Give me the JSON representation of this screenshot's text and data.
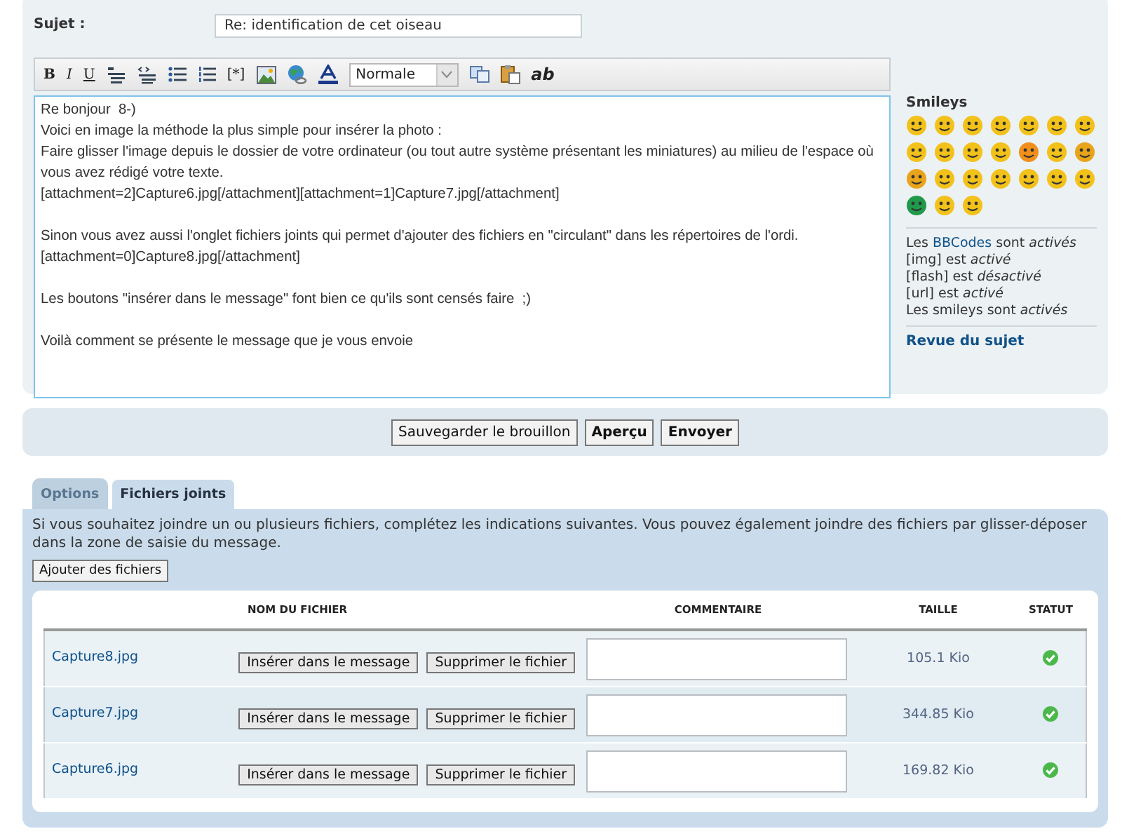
{
  "subject": {
    "label": "Sujet :",
    "value": "Re: identification de cet oiseau"
  },
  "toolbar": [
    {
      "kind": "bold",
      "label": "B"
    },
    {
      "kind": "italic",
      "label": "I"
    },
    {
      "kind": "underline",
      "label": "U"
    },
    {
      "kind": "quote"
    },
    {
      "kind": "code"
    },
    {
      "kind": "list"
    },
    {
      "kind": "list-numbered"
    },
    {
      "kind": "list-item",
      "label": "[*]"
    },
    {
      "kind": "image"
    },
    {
      "kind": "link"
    },
    {
      "kind": "color"
    },
    {
      "kind": "select",
      "value": "Normale"
    },
    {
      "kind": "copy"
    },
    {
      "kind": "paste"
    },
    {
      "kind": "spellcheck",
      "label": "ab"
    }
  ],
  "message": "Re bonjour  8-)\nVoici en image la méthode la plus simple pour insérer la photo :\nFaire glisser l'image depuis le dossier de votre ordinateur (ou tout autre système présentant les miniatures) au milieu de l'espace où vous avez rédigé votre texte.\n[attachment=2]Capture6.jpg[/attachment][attachment=1]Capture7.jpg[/attachment]\n\nSinon vous avez aussi l'onglet fichiers joints qui permet d'ajouter des fichiers en \"circulant\" dans les répertoires de l'ordi.\n[attachment=0]Capture8.jpg[/attachment]\n\nLes boutons \"insérer dans le message\" font bien ce qu'ils sont censés faire  ;)\n\nVoilà comment se présente le message que je vous envoie",
  "sidebar": {
    "smileys_title": "Smileys",
    "smileys": [
      {
        "color": "#f2c21b"
      },
      {
        "color": "#f2c21b"
      },
      {
        "color": "#f2c21b"
      },
      {
        "color": "#f2c21b"
      },
      {
        "color": "#f2c21b"
      },
      {
        "color": "#f2c21b"
      },
      {
        "color": "#f2c21b"
      },
      {
        "color": "#f2c21b"
      },
      {
        "color": "#f2c21b"
      },
      {
        "color": "#f2c21b"
      },
      {
        "color": "#f2c21b"
      },
      {
        "color": "#f0901a"
      },
      {
        "color": "#f2c21b"
      },
      {
        "color": "#e8a41a"
      },
      {
        "color": "#e8a41a"
      },
      {
        "color": "#f2c21b"
      },
      {
        "color": "#f2c21b"
      },
      {
        "color": "#f2c21b"
      },
      {
        "color": "#f2c21b"
      },
      {
        "color": "#f2c21b"
      },
      {
        "color": "#f2c21b"
      },
      {
        "color": "#1f9a4a"
      },
      {
        "color": "#f2c21b"
      },
      {
        "color": "#f2c21b"
      }
    ],
    "status_lines": [
      {
        "before": "Les ",
        "link": "BBCodes",
        "after": " sont *activés*"
      },
      {
        "before": "[img] est *activé*"
      },
      {
        "before": "[flash] est *désactivé*"
      },
      {
        "before": "[url] est *activé*"
      },
      {
        "before": "Les smileys sont *activés*"
      }
    ],
    "review_link": "Revue du sujet"
  },
  "actions": [
    {
      "label": "Sauvegarder le brouillon",
      "primary": false
    },
    {
      "label": "Aperçu",
      "primary": true
    },
    {
      "label": "Envoyer",
      "primary": true
    }
  ],
  "tabs": [
    {
      "label": "Options",
      "selected": false
    },
    {
      "label": "Fichiers joints",
      "selected": true
    }
  ],
  "attachments": {
    "intro": "Si vous souhaitez joindre un ou plusieurs fichiers, complétez les indications suivantes. Vous pouvez également joindre des fichiers par glisser-déposer dans la zone de saisie du message.",
    "add_button": "Ajouter des fichiers",
    "columns": [
      "NOM DU FICHIER",
      "COMMENTAIRE",
      "TAILLE",
      "STATUT"
    ],
    "rows": [
      {
        "name": "Capture8.jpg",
        "insert": "Insérer dans le message",
        "delete": "Supprimer le fichier",
        "size": "105.1 Kio",
        "uploaded": true
      },
      {
        "name": "Capture7.jpg",
        "insert": "Insérer dans le message",
        "delete": "Supprimer le fichier",
        "size": "344.85 Kio",
        "uploaded": true
      },
      {
        "name": "Capture6.jpg",
        "insert": "Insérer dans le message",
        "delete": "Supprimer le fichier",
        "size": "169.82 Kio",
        "uploaded": true
      }
    ]
  }
}
